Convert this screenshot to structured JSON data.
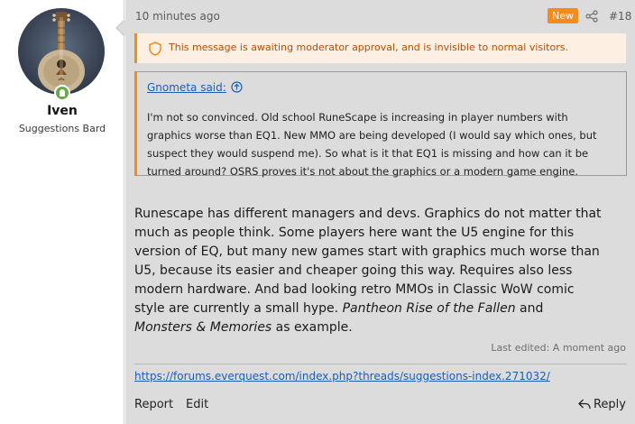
{
  "user": {
    "name": "Iven",
    "title": "Suggestions Bard",
    "avatar_icon": "lute-avatar",
    "status_icon": "online-user-icon",
    "status_color": "#6aa84f"
  },
  "message": {
    "time": "10 minutes ago",
    "new_badge": "New",
    "new_badge_color": "#f28c1c",
    "share_icon": "share-icon",
    "post_number": "#18",
    "moderation_notice": "This message is awaiting moderator approval, and is invisible to normal visitors.",
    "notice_icon": "shield-icon",
    "quote": {
      "author": "Gnometa said:",
      "jump_icon": "circle-up-arrow-icon",
      "lines": [
        "I'm not so convinced. Old school RuneScape is increasing in player numbers with",
        "graphics worse than EQ1. New MMO are being developed (I would say which ones, but",
        "suspect they would suspend me). So what is it that EQ1 is missing and how can it be",
        "turned around? OSRS proves it's not about the graphics or a modern game engine."
      ]
    },
    "body": {
      "lines": [
        "Runescape has different managers and devs. Graphics do not matter that",
        "much as people think. Some players here want the U5 engine for this",
        "version of EQ, but many new games start with graphics much worse than",
        "U5, because its easier and cheaper going this way. Requires also less",
        "modern hardware. And bad looking retro MMOs in Classic WoW comic"
      ],
      "line6_start": "style are currently a small hype. ",
      "line6_em": "Pantheon Rise of the Fallen",
      "line6_end": " and",
      "line7_em": "Monsters & Memories",
      "line7_end": " as example."
    },
    "last_edited": "Last edited: A moment ago",
    "signature_link": "https://forums.everquest.com/index.php?threads/suggestions-index.271032/",
    "actions": {
      "report": "Report",
      "edit": "Edit",
      "reply": "Reply",
      "reply_icon": "reply-arrow-icon"
    },
    "link_color": "#1a5fb4"
  }
}
